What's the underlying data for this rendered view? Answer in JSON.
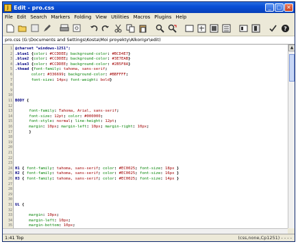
{
  "window": {
    "title": "Edit - pro.css",
    "btn_min": "_",
    "btn_max": "□",
    "btn_close": "×"
  },
  "menu": [
    "File",
    "Edit",
    "Search",
    "Markers",
    "Folding",
    "View",
    "Utilities",
    "Macros",
    "Plugins",
    "Help"
  ],
  "toolbar": [
    "new-file-icon",
    "open-folder-icon",
    "blank-icon",
    "pen-icon",
    "print-icon",
    "preview-icon",
    "undo-icon",
    "redo-icon",
    "cut-icon",
    "copy-icon",
    "paste-icon",
    "find-icon",
    "replace-icon",
    "fullscreen-icon",
    "box1-icon",
    "box2-icon",
    "box3-icon",
    "box4-icon",
    "bold-icon",
    "check-icon",
    "help-icon"
  ],
  "path": "pro.css (G:\\Documents and Settings\\Kosta\\Moi proyekty\\Alkon\\pr\\edit)",
  "code_lines": [
    {
      "n": "1",
      "parts": [
        [
          "sel",
          "@charset \"windows-1251\";"
        ]
      ]
    },
    {
      "n": "2",
      "parts": [
        [
          "sel",
          ".blue1 "
        ],
        [
          "punc",
          "{"
        ],
        [
          "prop",
          "color"
        ],
        [
          "punc",
          ": "
        ],
        [
          "val",
          "#CCDDEE"
        ],
        [
          "punc",
          "; "
        ],
        [
          "prop",
          "background-color"
        ],
        [
          "punc",
          ": "
        ],
        [
          "val",
          "#BCD4E7"
        ],
        [
          "punc",
          "}"
        ]
      ]
    },
    {
      "n": "3",
      "parts": [
        [
          "sel",
          ".blue2 "
        ],
        [
          "punc",
          "{"
        ],
        [
          "prop",
          "color"
        ],
        [
          "punc",
          ": "
        ],
        [
          "val",
          "#CCDDEE"
        ],
        [
          "punc",
          "; "
        ],
        [
          "prop",
          "background-color"
        ],
        [
          "punc",
          ": "
        ],
        [
          "val",
          "#3E7EAB"
        ],
        [
          "punc",
          "}"
        ]
      ]
    },
    {
      "n": "4",
      "parts": [
        [
          "sel",
          ".blue3 "
        ],
        [
          "punc",
          "{"
        ],
        [
          "prop",
          "color"
        ],
        [
          "punc",
          ": "
        ],
        [
          "val",
          "#CCDDEE"
        ],
        [
          "punc",
          "; "
        ],
        [
          "prop",
          "background-color"
        ],
        [
          "punc",
          ": "
        ],
        [
          "val",
          "#2B5F8A"
        ],
        [
          "punc",
          "}"
        ]
      ]
    },
    {
      "n": "5",
      "parts": [
        [
          "sel",
          ".thead "
        ],
        [
          "punc",
          "{"
        ],
        [
          "prop",
          "font-family"
        ],
        [
          "punc",
          ": "
        ],
        [
          "val",
          "tahoma, sans-serif"
        ],
        [
          "punc",
          ";"
        ]
      ]
    },
    {
      "n": "6",
      "parts": [
        [
          "prop",
          "       color"
        ],
        [
          "punc",
          ": "
        ],
        [
          "val",
          "#336699"
        ],
        [
          "punc",
          "; "
        ],
        [
          "prop",
          "background-color"
        ],
        [
          "punc",
          ": "
        ],
        [
          "val",
          "#BBFFFF"
        ],
        [
          "punc",
          ";"
        ]
      ]
    },
    {
      "n": "7",
      "parts": [
        [
          "prop",
          "       font-size"
        ],
        [
          "punc",
          ": "
        ],
        [
          "val",
          "14px"
        ],
        [
          "punc",
          "; "
        ],
        [
          "prop",
          "font-weight"
        ],
        [
          "punc",
          ": "
        ],
        [
          "val",
          "bold"
        ],
        [
          "punc",
          "}"
        ]
      ]
    },
    {
      "n": "8",
      "parts": []
    },
    {
      "n": "9",
      "parts": []
    },
    {
      "n": "10",
      "parts": []
    },
    {
      "n": "11",
      "parts": [
        [
          "sel",
          "BODY "
        ],
        [
          "punc",
          "{"
        ]
      ]
    },
    {
      "n": "12",
      "parts": []
    },
    {
      "n": "13",
      "parts": [
        [
          "prop",
          "      font-family"
        ],
        [
          "punc",
          ": "
        ],
        [
          "val",
          "Tahoma, Arial, sans-serif"
        ],
        [
          "punc",
          ";"
        ]
      ]
    },
    {
      "n": "14",
      "parts": [
        [
          "prop",
          "      font-size"
        ],
        [
          "punc",
          ": "
        ],
        [
          "val",
          "12pt"
        ],
        [
          "punc",
          "; "
        ],
        [
          "prop",
          "color"
        ],
        [
          "punc",
          ": "
        ],
        [
          "val",
          "#000000"
        ],
        [
          "punc",
          ";"
        ]
      ]
    },
    {
      "n": "15",
      "parts": [
        [
          "prop",
          "      font-style"
        ],
        [
          "punc",
          ": "
        ],
        [
          "val",
          "normal"
        ],
        [
          "punc",
          "; "
        ],
        [
          "prop",
          "line-height"
        ],
        [
          "punc",
          ": "
        ],
        [
          "val",
          "12pt"
        ],
        [
          "punc",
          ";"
        ]
      ]
    },
    {
      "n": "16",
      "parts": [
        [
          "prop",
          "      margin"
        ],
        [
          "punc",
          ": "
        ],
        [
          "val",
          "10px"
        ],
        [
          "punc",
          "; "
        ],
        [
          "prop",
          "margin-left"
        ],
        [
          "punc",
          ": "
        ],
        [
          "val",
          "10px"
        ],
        [
          "punc",
          "; "
        ],
        [
          "prop",
          "margin-right"
        ],
        [
          "punc",
          ": "
        ],
        [
          "val",
          "10px"
        ],
        [
          "punc",
          ";"
        ]
      ]
    },
    {
      "n": "17",
      "parts": [
        [
          "punc",
          "      }"
        ]
      ]
    },
    {
      "n": "18",
      "parts": []
    },
    {
      "n": "19",
      "parts": []
    },
    {
      "n": "20",
      "parts": []
    },
    {
      "n": "21",
      "parts": []
    },
    {
      "n": "22",
      "parts": []
    },
    {
      "n": "23",
      "parts": []
    },
    {
      "n": "24",
      "parts": [
        [
          "sel",
          "H1 "
        ],
        [
          "punc",
          "{ "
        ],
        [
          "prop",
          "font-family"
        ],
        [
          "punc",
          ": "
        ],
        [
          "val",
          "tahoma, sans-serif"
        ],
        [
          "punc",
          "; "
        ],
        [
          "prop",
          "color"
        ],
        [
          "punc",
          ": "
        ],
        [
          "val",
          "#EC0025"
        ],
        [
          "punc",
          "; "
        ],
        [
          "prop",
          "font-size"
        ],
        [
          "punc",
          ": "
        ],
        [
          "val",
          "18px"
        ],
        [
          "punc",
          " }"
        ]
      ]
    },
    {
      "n": "25",
      "parts": [
        [
          "sel",
          "H2 "
        ],
        [
          "punc",
          "{ "
        ],
        [
          "prop",
          "font-family"
        ],
        [
          "punc",
          ": "
        ],
        [
          "val",
          "tahoma, sans-serif"
        ],
        [
          "punc",
          "; "
        ],
        [
          "prop",
          "color"
        ],
        [
          "punc",
          ": "
        ],
        [
          "val",
          "#EC0025"
        ],
        [
          "punc",
          "; "
        ],
        [
          "prop",
          "font-size"
        ],
        [
          "punc",
          ": "
        ],
        [
          "val",
          "16px"
        ],
        [
          "punc",
          " }"
        ]
      ]
    },
    {
      "n": "26",
      "parts": [
        [
          "sel",
          "H3 "
        ],
        [
          "punc",
          "{ "
        ],
        [
          "prop",
          "font-family"
        ],
        [
          "punc",
          ": "
        ],
        [
          "val",
          "tahoma, sans-serif"
        ],
        [
          "punc",
          "; "
        ],
        [
          "prop",
          "color"
        ],
        [
          "punc",
          ": "
        ],
        [
          "val",
          "#EC0025"
        ],
        [
          "punc",
          "; "
        ],
        [
          "prop",
          "font-size"
        ],
        [
          "punc",
          ": "
        ],
        [
          "val",
          "14px"
        ],
        [
          "punc",
          " }"
        ]
      ]
    },
    {
      "n": "27",
      "parts": []
    },
    {
      "n": "28",
      "parts": []
    },
    {
      "n": "29",
      "parts": []
    },
    {
      "n": "30",
      "parts": []
    },
    {
      "n": "31",
      "parts": [
        [
          "sel",
          "UL "
        ],
        [
          "punc",
          "{"
        ]
      ]
    },
    {
      "n": "32",
      "parts": []
    },
    {
      "n": "33",
      "parts": [
        [
          "prop",
          "      margin"
        ],
        [
          "punc",
          ": "
        ],
        [
          "val",
          "10px"
        ],
        [
          "punc",
          ";"
        ]
      ]
    },
    {
      "n": "34",
      "parts": [
        [
          "prop",
          "      margin-left"
        ],
        [
          "punc",
          ": "
        ],
        [
          "val",
          "10px"
        ],
        [
          "punc",
          ";"
        ]
      ]
    },
    {
      "n": "35",
      "parts": [
        [
          "prop",
          "      margin-bottom"
        ],
        [
          "punc",
          ": "
        ],
        [
          "val",
          "10px"
        ],
        [
          "punc",
          ";"
        ]
      ]
    }
  ],
  "status": {
    "left": "1:41 Top",
    "right": "(css,none,Cp1251) - - - -"
  },
  "colors": {
    "title_bar": "#0a4fd6",
    "selector": "#000080",
    "property": "#008000",
    "value": "#a00000"
  }
}
